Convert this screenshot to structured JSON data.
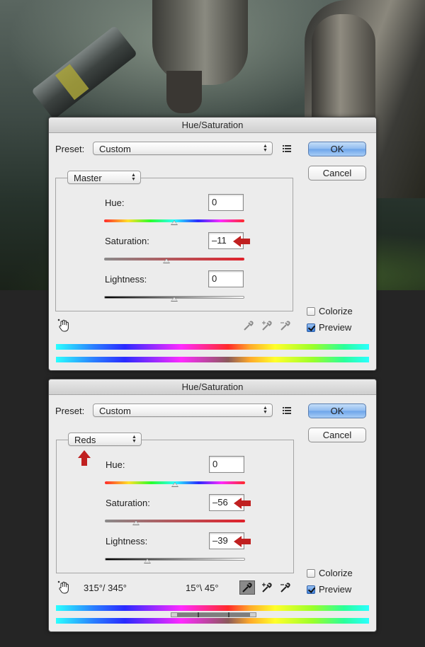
{
  "dialogs": [
    {
      "title": "Hue/Saturation",
      "preset_label": "Preset:",
      "preset_value": "Custom",
      "ok_label": "OK",
      "cancel_label": "Cancel",
      "channel": "Master",
      "hue_label": "Hue:",
      "hue_value": "0",
      "saturation_label": "Saturation:",
      "saturation_value": "–11",
      "lightness_label": "Lightness:",
      "lightness_value": "0",
      "colorize_label": "Colorize",
      "colorize_checked": false,
      "preview_label": "Preview",
      "preview_checked": true,
      "sliders": {
        "hue": 0,
        "saturation": -11,
        "lightness": 0
      }
    },
    {
      "title": "Hue/Saturation",
      "preset_label": "Preset:",
      "preset_value": "Custom",
      "ok_label": "OK",
      "cancel_label": "Cancel",
      "channel": "Reds",
      "hue_label": "Hue:",
      "hue_value": "0",
      "saturation_label": "Saturation:",
      "saturation_value": "–56",
      "lightness_label": "Lightness:",
      "lightness_value": "–39",
      "colorize_label": "Colorize",
      "colorize_checked": false,
      "preview_label": "Preview",
      "preview_checked": true,
      "range_left": "315°/ 345°",
      "range_right": "15°\\ 45°",
      "sliders": {
        "hue": 0,
        "saturation": -56,
        "lightness": -39
      }
    }
  ],
  "colors": {
    "annotation_arrow": "#c02020",
    "ok_button": "#6da4ea"
  },
  "icons": [
    "menu-icon",
    "targeted-adjustment-hand-icon",
    "eyedropper-icon",
    "eyedropper-plus-icon",
    "eyedropper-minus-icon",
    "red-arrow-icon"
  ]
}
